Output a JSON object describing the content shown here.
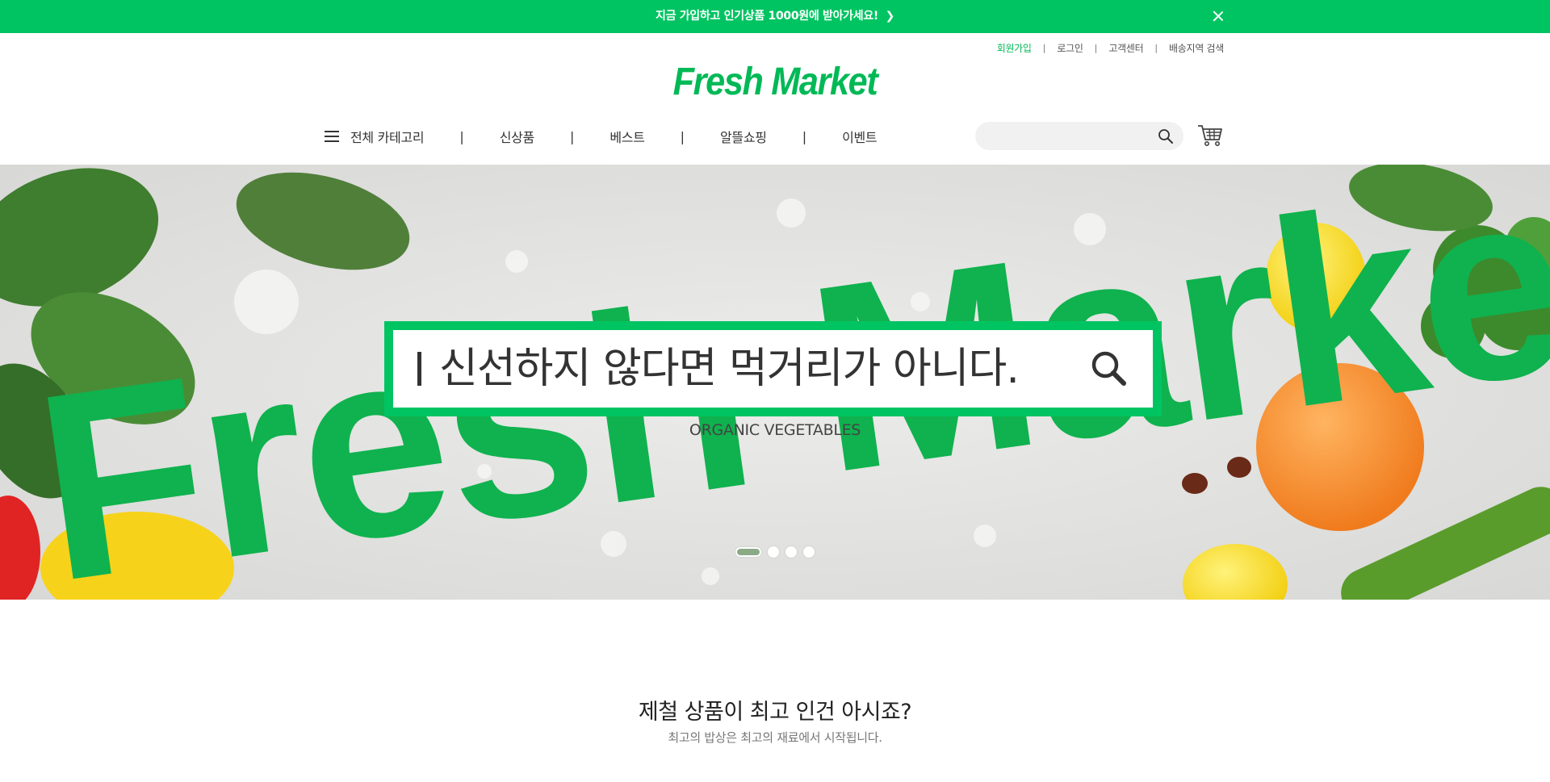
{
  "top_banner": {
    "text": "지금 가입하고 인기상품 1000원에 받아가세요!",
    "chevron": "❯",
    "close_icon": "close-icon",
    "background_color": "#00c462"
  },
  "util_nav": {
    "items": [
      {
        "label": "회원가입",
        "color": "#00b956"
      },
      {
        "label": "로그인"
      },
      {
        "label": "고객센터"
      },
      {
        "label": "배송지역 검색"
      }
    ],
    "separator": "|"
  },
  "logo": {
    "text": "Fresh Market",
    "color": "#00b956"
  },
  "main_nav": {
    "menu_icon": "hamburger-icon",
    "items": [
      {
        "label": "전체 카테고리"
      },
      {
        "label": "신상품"
      },
      {
        "label": "베스트"
      },
      {
        "label": "알뜰쇼핑"
      },
      {
        "label": "이벤트"
      }
    ],
    "separator": "|"
  },
  "search": {
    "value": "",
    "icon": "search-icon"
  },
  "cart": {
    "icon": "cart-icon"
  },
  "hero": {
    "background_text": "Fresh Market",
    "background_text_color": "#0fb24e",
    "search_text": "신선하지 않다면 먹거리가 아니다.",
    "search_icon": "search-icon",
    "subtitle": "ORGANIC VEGETABLES",
    "slides_total": 4,
    "active_slide": 1
  },
  "section": {
    "title": "제철 상품이 최고 인건 아시죠?",
    "subtitle": "최고의 밥상은 최고의 재료에서 시작됩니다."
  }
}
